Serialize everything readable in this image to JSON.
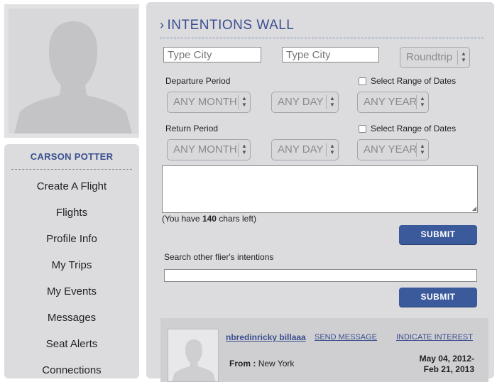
{
  "profile": {
    "name": "CARSON POTTER",
    "menu": [
      {
        "label": "Create A Flight",
        "name": "menu-create-a-flight"
      },
      {
        "label": "Flights",
        "name": "menu-flights"
      },
      {
        "label": "Profile Info",
        "name": "menu-profile-info"
      },
      {
        "label": "My Trips",
        "name": "menu-my-trips"
      },
      {
        "label": "My Events",
        "name": "menu-my-events"
      },
      {
        "label": "Messages",
        "name": "menu-messages"
      },
      {
        "label": "Seat Alerts",
        "name": "menu-seat-alerts"
      },
      {
        "label": "Connections",
        "name": "menu-connections"
      }
    ]
  },
  "wall": {
    "chevron": "›",
    "title": "INTENTIONS WALL",
    "from_city_placeholder": "Type City",
    "to_city_placeholder": "Type City",
    "trip_type": "Roundtrip",
    "departure_label": "Departure Period",
    "return_label": "Return Period",
    "range_label": "Select Range of Dates",
    "any_month": "ANY MONTH",
    "any_day": "ANY DAY",
    "any_year": "ANY YEAR",
    "chars_prefix": "(You have ",
    "chars_count": "140",
    "chars_suffix": " chars left)",
    "submit_label": "SUBMIT",
    "search_label": "Search other flier's intentions"
  },
  "result": {
    "user": "nbredinricky billaaa",
    "send_message": "SEND MESSAGE",
    "indicate_interest": "INDICATE INTEREST",
    "from_label": "From :",
    "from_value": "New York",
    "date_range_line1": "May 04, 2012-",
    "date_range_line2": "Feb 21, 2013"
  },
  "colors": {
    "accent": "#3b4f8f",
    "button": "#3b5a9c",
    "panel": "#dcdcdf"
  }
}
